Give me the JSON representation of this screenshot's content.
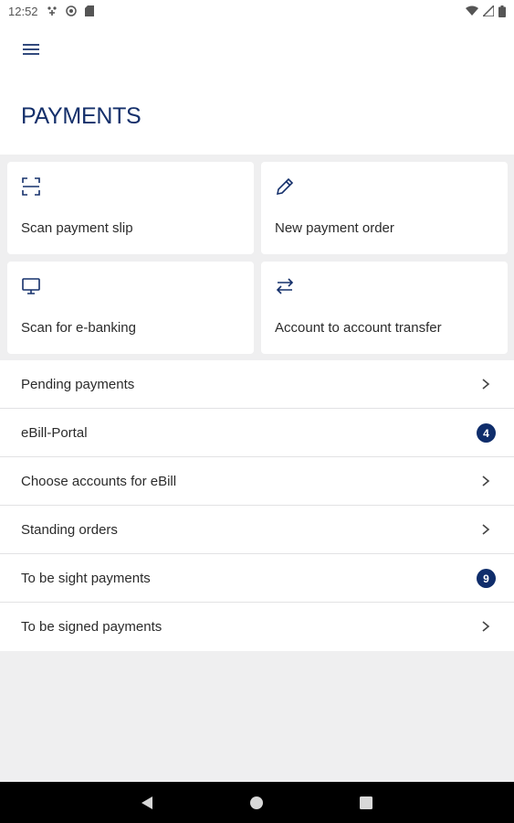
{
  "status_bar": {
    "time": "12:52",
    "icons": [
      "notification-icon",
      "sync-icon",
      "sd-card-icon",
      "wifi-icon",
      "signal-icon",
      "battery-icon"
    ]
  },
  "header": {
    "title": "PAYMENTS",
    "menu_icon": "hamburger-menu-icon"
  },
  "tiles": [
    {
      "label": "Scan payment slip",
      "icon": "scan-frame-icon"
    },
    {
      "label": "New payment order",
      "icon": "pencil-icon"
    },
    {
      "label": "Scan for e-banking",
      "icon": "monitor-icon"
    },
    {
      "label": "Account to account transfer",
      "icon": "transfer-arrows-icon"
    }
  ],
  "list": [
    {
      "label": "Pending payments",
      "trailing": "chevron"
    },
    {
      "label": "eBill-Portal",
      "badge": "4"
    },
    {
      "label": "Choose accounts for eBill",
      "trailing": "chevron"
    },
    {
      "label": "Standing orders",
      "trailing": "chevron"
    },
    {
      "label": "To be sight payments",
      "badge": "9"
    },
    {
      "label": "To be signed payments",
      "trailing": "chevron"
    }
  ],
  "nav_bar": {
    "buttons": [
      "back-icon",
      "home-icon",
      "recents-icon"
    ]
  },
  "colors": {
    "accent": "#15306b",
    "badge": "#0f2d6b",
    "background": "#efeff0",
    "surface": "#ffffff"
  }
}
